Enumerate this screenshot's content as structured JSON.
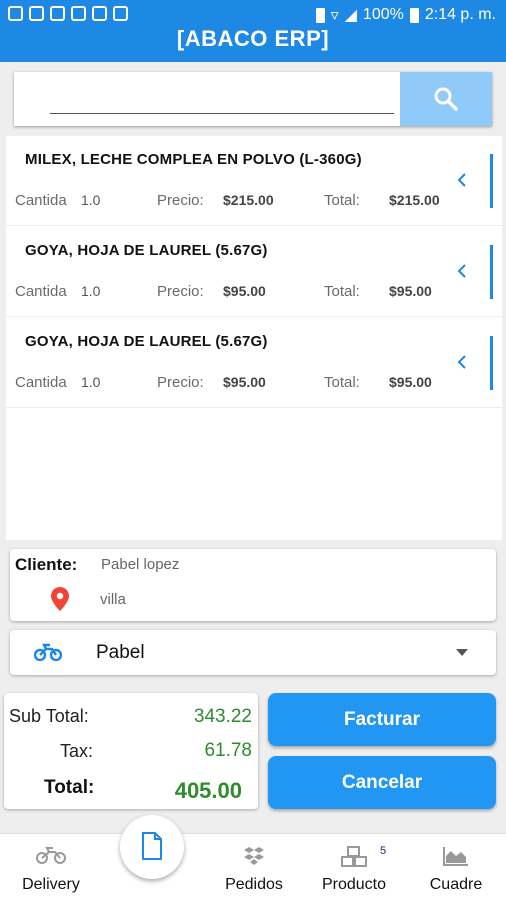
{
  "status_bar": {
    "battery": "100%",
    "time": "2:14 p. m."
  },
  "app": {
    "title": "[ABACO ERP]"
  },
  "search": {
    "value": "",
    "placeholder": ""
  },
  "items": [
    {
      "name": "MILEX, LECHE COMPLEA EN POLVO (L-360G)",
      "qty_label": "Cantida",
      "qty": "1.0",
      "price_label": "Precio:",
      "price": "$215.00",
      "total_label": "Total:",
      "total": "$215.00"
    },
    {
      "name": "GOYA, HOJA DE LAUREL (5.67G)",
      "qty_label": "Cantida",
      "qty": "1.0",
      "price_label": "Precio:",
      "price": "$95.00",
      "total_label": "Total:",
      "total": "$95.00"
    },
    {
      "name": "GOYA, HOJA DE LAUREL (5.67G)",
      "qty_label": "Cantida",
      "qty": "1.0",
      "price_label": "Precio:",
      "price": "$95.00",
      "total_label": "Total:",
      "total": "$95.00"
    }
  ],
  "client": {
    "label": "Cliente:",
    "name": "Pabel lopez",
    "address": "villa"
  },
  "driver": {
    "selected": "Pabel"
  },
  "totals": {
    "subtotal_label": "Sub Total:",
    "subtotal": "343.22",
    "tax_label": "Tax:",
    "tax": "61.78",
    "total_label": "Total:",
    "total": "405.00"
  },
  "actions": {
    "invoice": "Facturar",
    "cancel": "Cancelar"
  },
  "nav": {
    "delivery": "Delivery",
    "orders": "Pedidos",
    "products": "Producto",
    "products_badge": "5",
    "close": "Cuadre"
  },
  "colors": {
    "primary": "#1e88e5",
    "button": "#2196f3",
    "search_button": "#90caf9",
    "total_green": "#2e8b2e",
    "pin_red": "#f44336"
  }
}
